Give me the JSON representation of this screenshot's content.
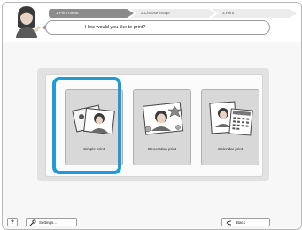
{
  "header": {
    "steps": [
      "1.Print menu",
      "2.Choose image",
      "3.Print"
    ],
    "prompt": "How would you like to print?"
  },
  "options": [
    {
      "label": "Simple print",
      "selected": true
    },
    {
      "label": "Decoration print",
      "selected": false
    },
    {
      "label": "Calendar print",
      "selected": false
    }
  ],
  "footer": {
    "help_label": "?",
    "settings_label": "Settings...",
    "back_label": "Back"
  },
  "colors": {
    "selection_ring": "#1f9bdb"
  },
  "icons": {
    "assistant": "assistant-avatar-icon",
    "settings": "wrench-icon",
    "back": "back-arrow-icon"
  }
}
